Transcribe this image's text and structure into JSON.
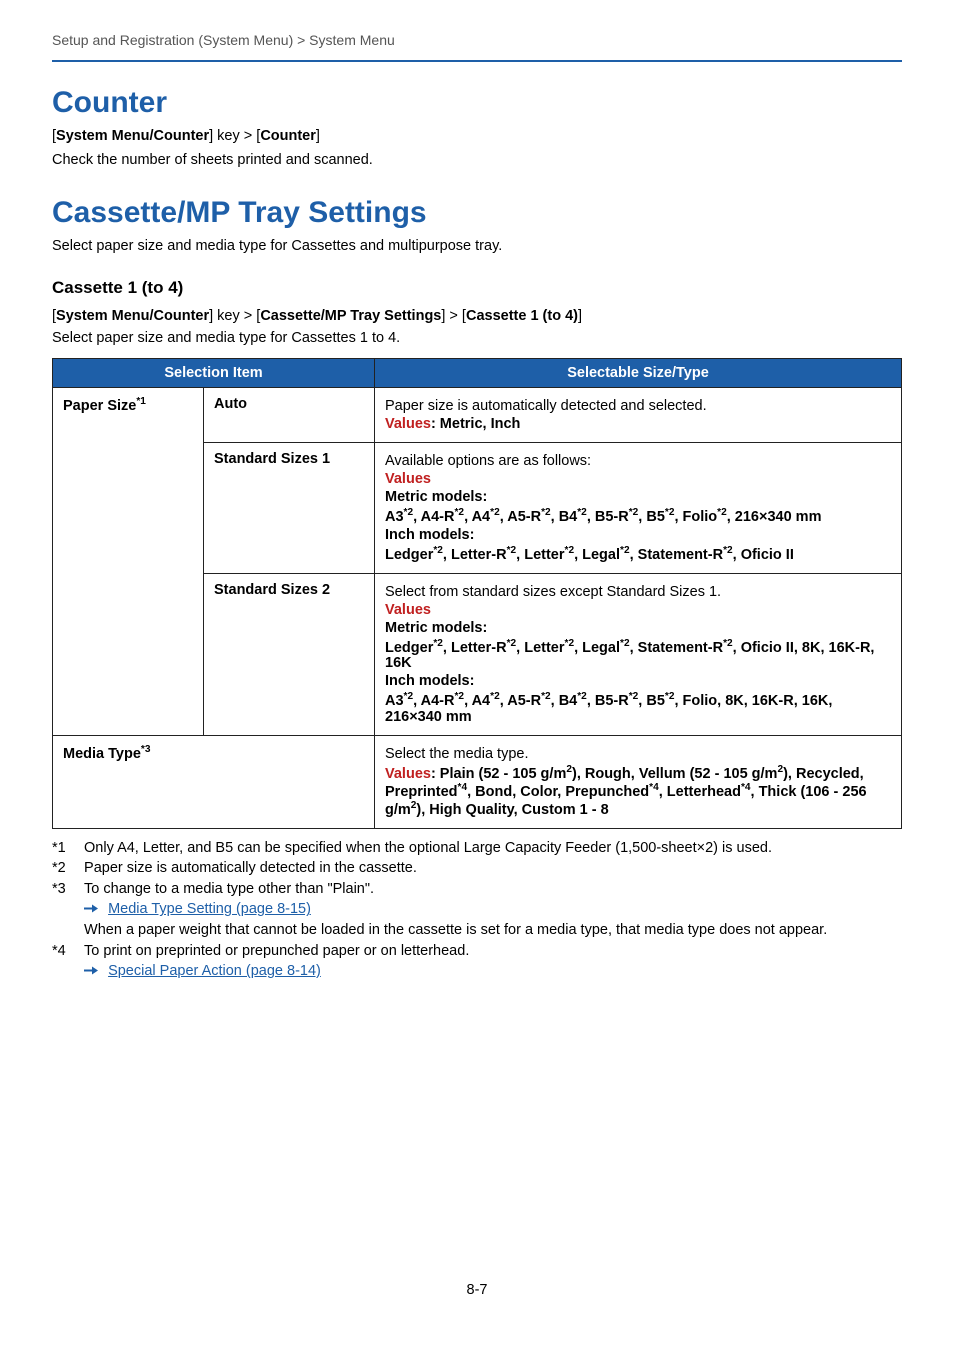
{
  "breadcrumb": "Setup and Registration (System Menu) > System Menu",
  "counter": {
    "heading": "Counter",
    "path_prefix": "[",
    "path_key1": "System Menu/Counter",
    "path_mid": "] key > [",
    "path_key2": "Counter",
    "path_suffix": "]",
    "body": "Check the number of sheets printed and scanned."
  },
  "cassette": {
    "heading": "Cassette/MP Tray Settings",
    "intro": "Select paper size and media type for Cassettes and multipurpose tray.",
    "subhead": "Cassette 1 (to 4)",
    "path_prefix": "[",
    "path_key1": "System Menu/Counter",
    "path_mid1": "] key > [",
    "path_key2": "Cassette/MP Tray Settings",
    "path_mid2": "] > [",
    "path_key3": "Cassette 1 (to 4)",
    "path_suffix": "]",
    "intro2": "Select paper size and media type for Cassettes 1 to 4."
  },
  "table": {
    "header1": "Selection Item",
    "header2": "Selectable Size/Type",
    "row1": {
      "label": "Paper Size",
      "sup": "*1",
      "opt": "Auto",
      "desc_line1": "Paper size is automatically detected and selected.",
      "values_word": "Values",
      "values_text": ": Metric, Inch"
    },
    "row2": {
      "opt": "Standard Sizes 1",
      "l1": "Available options are as follows:",
      "values_word": "Values",
      "metric_label": "Metric models:",
      "metric_sizes_prefix": "A3",
      "s2": "*2",
      "metric_sizes_tail": ", 216×340  mm",
      "inch_label": "Inch models:",
      "inch_sizes_tail": ", Oficio II"
    },
    "row3": {
      "opt": "Standard Sizes 2",
      "l1": "Select from standard sizes except Standard Sizes 1.",
      "values_word": "Values",
      "metric_label": "Metric models:",
      "metric_tail": ", Oficio II, 8K, 16K-R, 16K",
      "inch_label": "Inch models:",
      "inch_tail": ", Folio, 8K, 16K-R, 16K, 216×340  mm"
    },
    "row4": {
      "label": "Media Type",
      "sup": "*3",
      "l1": "Select the media type.",
      "values_word": "Values",
      "v_prefix": ": Plain (52 - 105 g/m",
      "sq": "2",
      "v_p2": "), Rough, Vellum (52 - 105 g/m",
      "v_p3": "), Recycled, Preprinted",
      "s4": "*4",
      "v_p4": ", Bond, Color, Prepunched",
      "v_p5": ", Letterhead",
      "v_p6": ", Thick (106 - 256 g/m",
      "v_p7": "), High Quality, Custom 1 - 8"
    }
  },
  "footnotes": {
    "f1_label": "*1",
    "f1": "Only A4, Letter, and B5 can be specified when the optional Large Capacity Feeder (1,500-sheet×2) is used.",
    "f2_label": "*2",
    "f2": "Paper size is automatically detected in the cassette.",
    "f3_label": "*3",
    "f3": "To change to a media type other than \"Plain\".",
    "f3_link": "Media Type Setting (page 8-15)",
    "f3b": "When a paper weight that cannot be loaded in the cassette is set for a media type, that media type does not appear.",
    "f4_label": "*4",
    "f4": "To print on preprinted or prepunched paper or on letterhead.",
    "f4_link": "Special Paper Action (page 8-14)"
  },
  "sizes": {
    "a3": "A3",
    "a4r": ", A4-R",
    "a4": ", A4",
    "a5r": ", A5-R",
    "b4": ", B4",
    "b5r": ", B5-R",
    "b5": ", B5",
    "folio": ", Folio",
    "ledger": "Ledger",
    "letterr": ", Letter-R",
    "letter": ", Letter",
    "legal": ", Legal",
    "stmtr": ", Statement-R"
  },
  "page_num": "8-7"
}
